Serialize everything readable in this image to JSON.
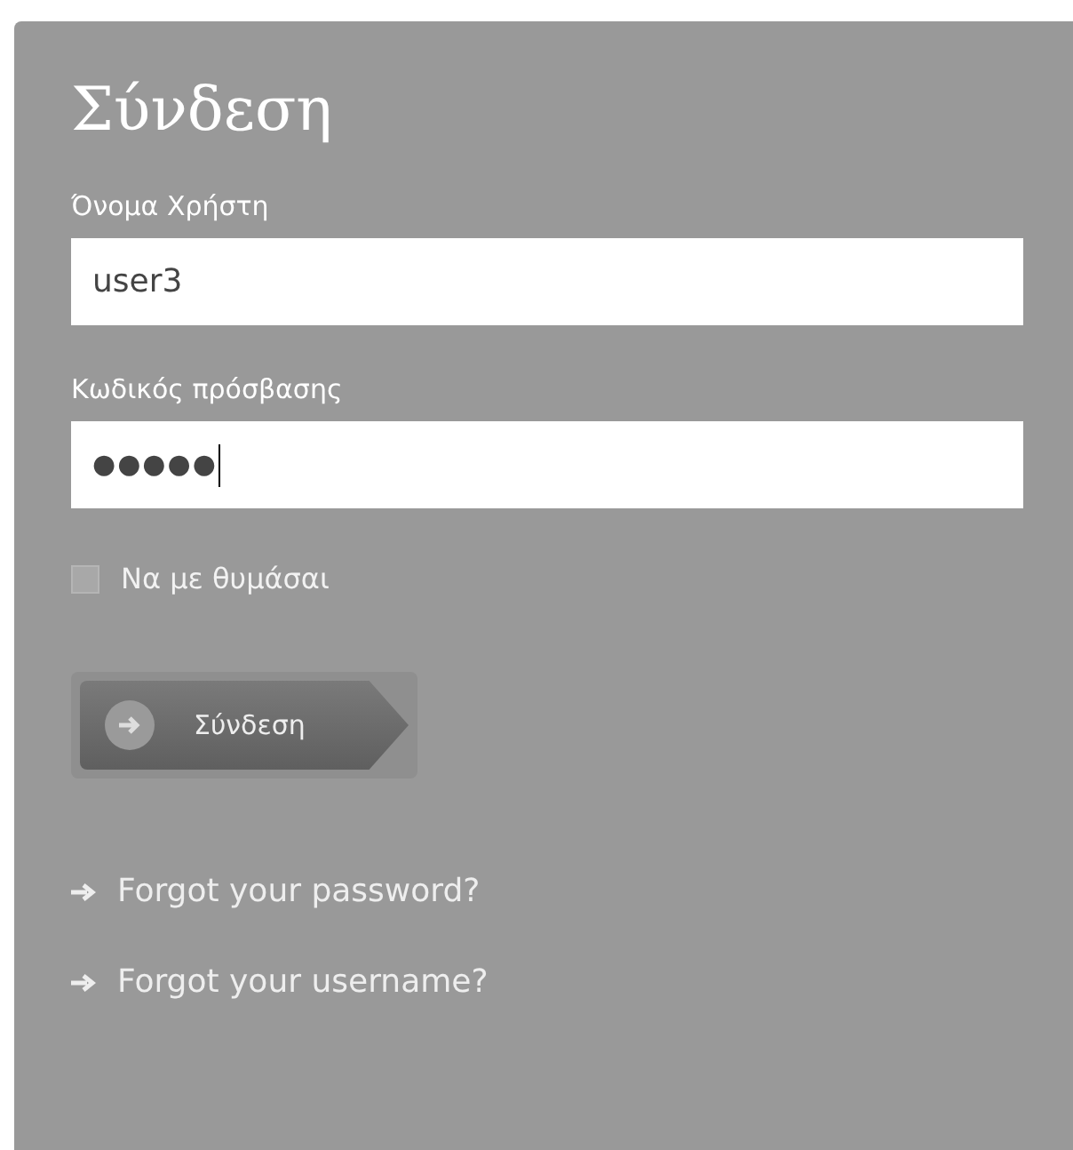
{
  "title": "Σύνδεση",
  "fields": [
    {
      "label": "Όνομα Χρήστη",
      "value": "user3",
      "kind": "text"
    },
    {
      "label": "Κωδικός πρόσβασης",
      "value": "●●●●●",
      "kind": "password",
      "focused": true
    }
  ],
  "remember": {
    "label": "Να με θυμάσαι",
    "checked": false
  },
  "submit": {
    "label": "Σύνδεση"
  },
  "links": [
    "Forgot your password?",
    "Forgot your username?"
  ]
}
